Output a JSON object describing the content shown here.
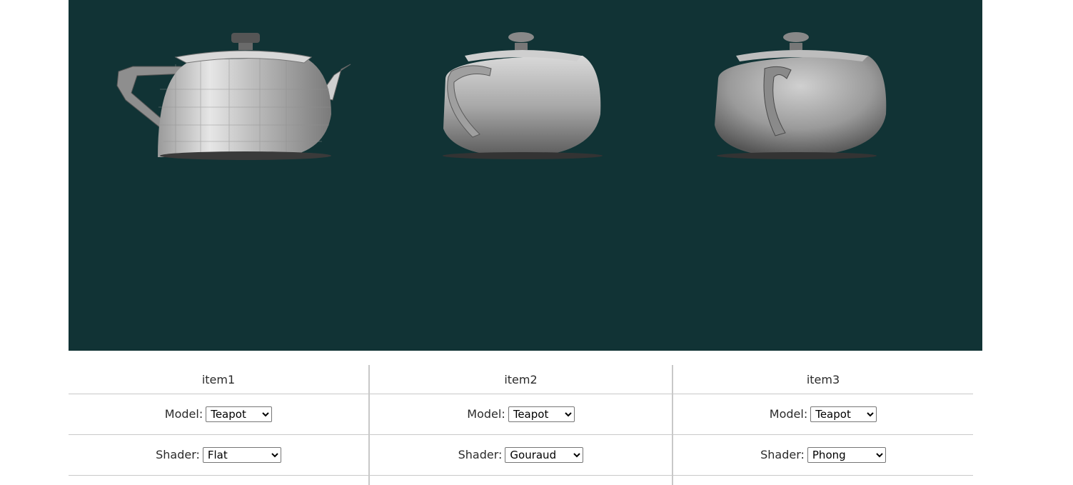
{
  "viewport": {
    "background": "#113335",
    "objects": [
      {
        "name": "Teapot",
        "shader": "Flat"
      },
      {
        "name": "Teapot",
        "shader": "Gouraud"
      },
      {
        "name": "Teapot",
        "shader": "Phong"
      }
    ]
  },
  "columns": [
    {
      "title": "item1",
      "model_label": "Model:",
      "model_value": "Teapot",
      "model_options": [
        "Teapot"
      ],
      "shader_label": "Shader:",
      "shader_value": "Flat",
      "shader_options": [
        "Flat",
        "Gouraud",
        "Phong"
      ]
    },
    {
      "title": "item2",
      "model_label": "Model:",
      "model_value": "Teapot",
      "model_options": [
        "Teapot"
      ],
      "shader_label": "Shader:",
      "shader_value": "Gouraud",
      "shader_options": [
        "Flat",
        "Gouraud",
        "Phong"
      ]
    },
    {
      "title": "item3",
      "model_label": "Model:",
      "model_value": "Teapot",
      "model_options": [
        "Teapot"
      ],
      "shader_label": "Shader:",
      "shader_value": "Phong",
      "shader_options": [
        "Flat",
        "Gouraud",
        "Phong"
      ]
    }
  ]
}
